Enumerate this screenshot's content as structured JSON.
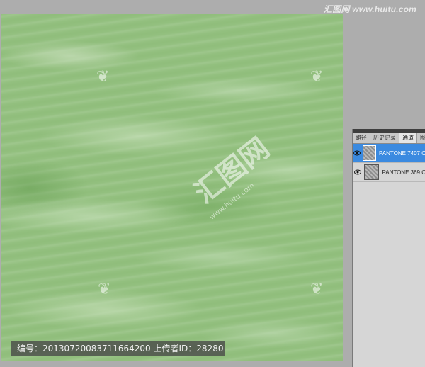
{
  "watermark_top": "汇图网 www.huitu.com",
  "canvas": {
    "center_watermark": "汇图网",
    "center_url": "www.huitu.com"
  },
  "infobar": {
    "text": "编号：20130720083711664200 上传者ID：28280"
  },
  "panel": {
    "tabs": [
      {
        "label": "路径",
        "active": false
      },
      {
        "label": "历史记录",
        "active": false
      },
      {
        "label": "通道",
        "active": true
      },
      {
        "label": "图",
        "active": false
      }
    ],
    "channels": [
      {
        "label": "PANTONE 7407 C",
        "selected": true
      },
      {
        "label": "PANTONE 369 C",
        "selected": false
      }
    ]
  },
  "colors": {
    "marble_green": "#93c07f",
    "selection_blue": "#3b8ae0",
    "panel_bg": "#d6d6d6"
  }
}
